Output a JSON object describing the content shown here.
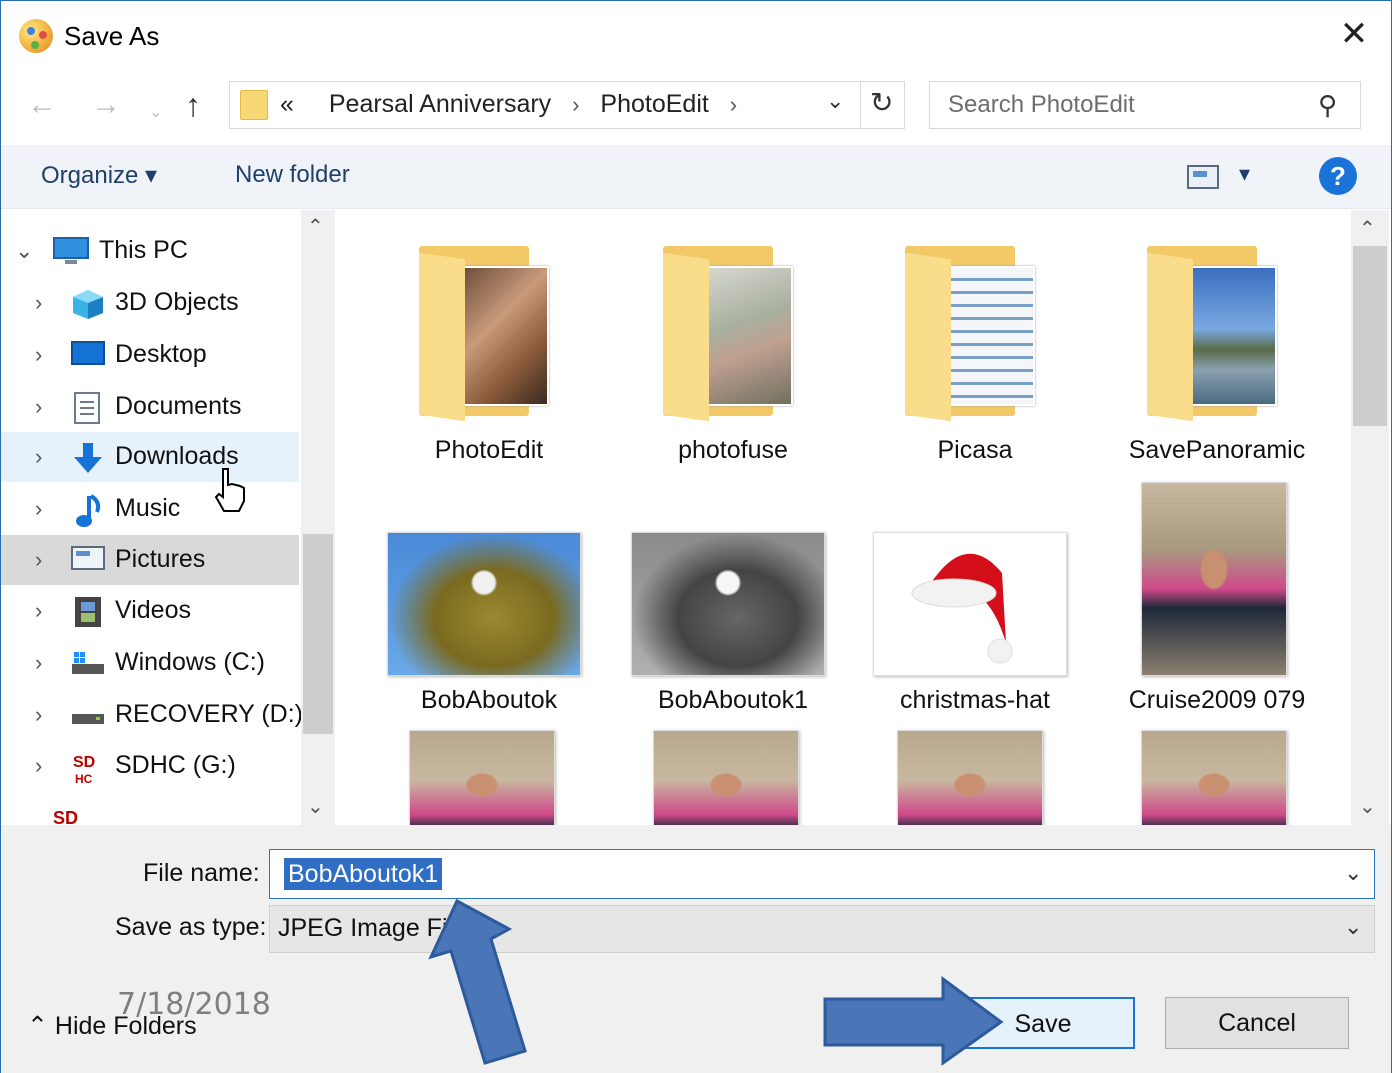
{
  "window": {
    "title": "Save As",
    "close_glyph": "✕"
  },
  "address_bar": {
    "overflow_glyph": "«",
    "crumbs": [
      "Pearsal Anniversary",
      "PhotoEdit"
    ],
    "separator": "›",
    "trailing_separator": "›"
  },
  "search": {
    "placeholder": "Search PhotoEdit"
  },
  "commands": {
    "organize": "Organize ▾",
    "new_folder": "New folder",
    "help": "?"
  },
  "nav_pane": {
    "items": [
      {
        "label": "This PC",
        "icon": "monitor-icon",
        "expanded": true
      },
      {
        "label": "3D Objects",
        "icon": "cube-icon"
      },
      {
        "label": "Desktop",
        "icon": "desktop-icon"
      },
      {
        "label": "Documents",
        "icon": "document-icon"
      },
      {
        "label": "Downloads",
        "icon": "download-arrow-icon",
        "state": "hover"
      },
      {
        "label": "Music",
        "icon": "music-note-icon"
      },
      {
        "label": "Pictures",
        "icon": "pictures-icon",
        "state": "selected"
      },
      {
        "label": "Videos",
        "icon": "film-icon"
      },
      {
        "label": "Windows (C:)",
        "icon": "drive-icon"
      },
      {
        "label": "RECOVERY (D:)",
        "icon": "drive-icon"
      },
      {
        "label": "SDHC (G:)",
        "icon": "sd-card-icon"
      }
    ]
  },
  "files": [
    {
      "name": "PhotoEdit",
      "kind": "folder"
    },
    {
      "name": "photofuse",
      "kind": "folder"
    },
    {
      "name": "Picasa",
      "kind": "folder"
    },
    {
      "name": "SavePanoramic",
      "kind": "folder"
    },
    {
      "name": "BobAboutok",
      "kind": "image"
    },
    {
      "name": "BobAboutok1",
      "kind": "image"
    },
    {
      "name": "christmas-hat",
      "kind": "image"
    },
    {
      "name": "Cruise2009 079",
      "kind": "image"
    }
  ],
  "form": {
    "file_name_label": "File name:",
    "file_name_value": "BobAboutok1",
    "save_type_label": "Save as type:",
    "save_type_value": "JPEG Image Fil"
  },
  "footer": {
    "hide_folders": "Hide Folders",
    "save": "Save",
    "cancel": "Cancel",
    "date_overlay": "7/18/2018"
  },
  "colors": {
    "accent": "#1a73d9",
    "annotation_arrow": "#4a76b8",
    "selection": "#2f6ec4"
  }
}
